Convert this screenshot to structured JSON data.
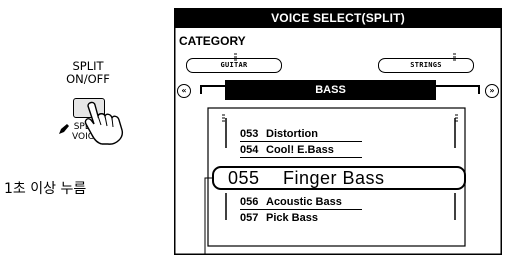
{
  "button": {
    "title_line1": "SPLIT",
    "title_line2": "ON/OFF",
    "sub_line1": "SPLIT",
    "sub_line2": "VOICE",
    "hold_note": "1초 이상 누름"
  },
  "lcd": {
    "header": "VOICE SELECT(SPLIT)",
    "category_label": "CATEGORY",
    "category_prev": "GUITAR",
    "category_next": "STRINGS",
    "category_current": "BASS",
    "prev_icon": "double-left-arrow",
    "next_icon": "double-right-arrow",
    "voices_above": [
      {
        "number": "053",
        "name": "Distortion"
      },
      {
        "number": "054",
        "name": "Cool! E.Bass"
      }
    ],
    "selected": {
      "number": "055",
      "name": "Finger Bass"
    },
    "voices_below": [
      {
        "number": "056",
        "name": "Acoustic Bass"
      },
      {
        "number": "057",
        "name": "Pick Bass"
      }
    ]
  }
}
